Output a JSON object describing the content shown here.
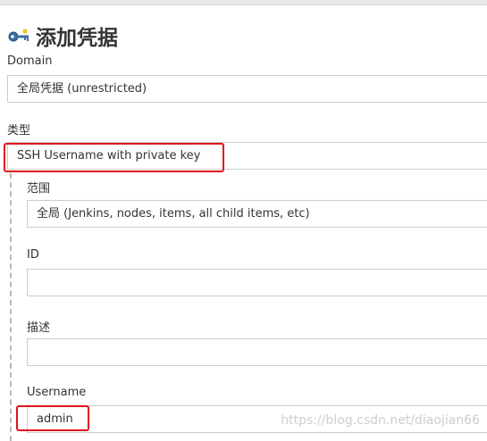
{
  "header": {
    "title": "添加凭据",
    "icon": "credentials-key-icon"
  },
  "form": {
    "domain": {
      "label": "Domain",
      "value": "全局凭据 (unrestricted)"
    },
    "kind": {
      "label": "类型",
      "value": "SSH Username with private key"
    },
    "scope": {
      "label": "范围",
      "value": "全局 (Jenkins, nodes, items, all child items, etc)"
    },
    "id": {
      "label": "ID",
      "value": ""
    },
    "description": {
      "label": "描述",
      "value": ""
    },
    "username": {
      "label": "Username",
      "value": "admin"
    }
  },
  "watermark": "https://blog.csdn.net/diaojian66",
  "colors": {
    "highlight": "#e0141e",
    "field_border": "#cccccc",
    "text": "#333333"
  }
}
